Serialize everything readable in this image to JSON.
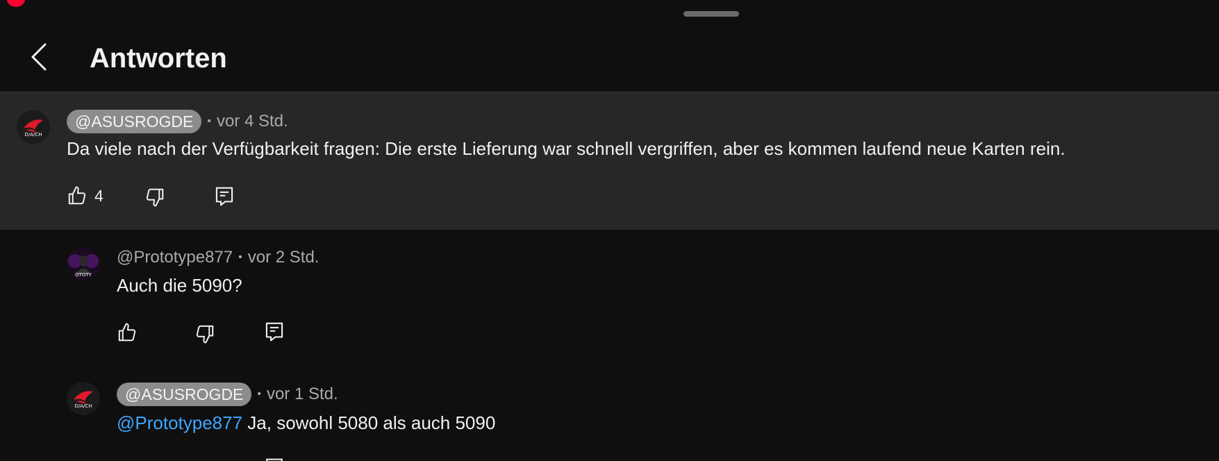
{
  "header": {
    "title": "Antworten",
    "back_icon": "chevron-left-icon"
  },
  "main_comment": {
    "handle": "@ASUSROGDE",
    "separator": "•",
    "time": "vor 4 Std.",
    "text": "Da viele nach der Verfügbarkeit fragen: Die erste Lieferung war schnell vergriffen, aber es kommen laufend neue Karten rein.",
    "likes": "4",
    "avatar_label": "D/A/CH"
  },
  "replies": [
    {
      "handle": "@Prototype877",
      "separator": "•",
      "time": "vor 2 Std.",
      "text": "Auch die 5090?",
      "avatar_label": "OTOTY"
    },
    {
      "handle": "@ASUSROGDE",
      "separator": "•",
      "time": "vor 1 Std.",
      "mention": "@Prototype877",
      "text": " Ja, sowohl 5080 als auch 5090",
      "avatar_label": "D/A/CH"
    }
  ],
  "colors": {
    "background": "#0f0f0f",
    "highlight": "#272727",
    "mention": "#3ea6ff",
    "handle_pill": "#8c8c8c",
    "rog_red": "#e1192d"
  }
}
